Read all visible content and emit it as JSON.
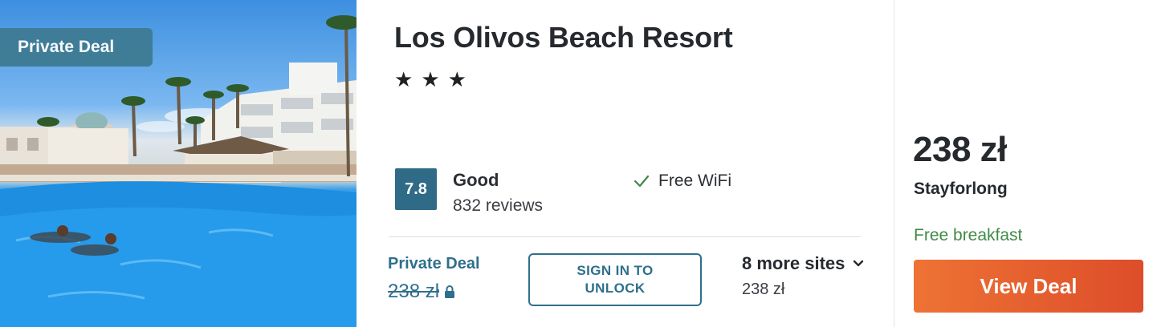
{
  "photo": {
    "badge": "Private Deal",
    "image_label": "hotel-pool-photo"
  },
  "hotel": {
    "name": "Los Olivos Beach Resort",
    "stars": [
      "★",
      "★",
      "★"
    ],
    "star_count": 3
  },
  "rating": {
    "score": "7.8",
    "label": "Good",
    "reviews": "832 reviews",
    "color": "#2f6a87"
  },
  "amenities": [
    {
      "icon": "check-icon",
      "label": "Free WiFi"
    }
  ],
  "private_deal": {
    "label": "Private Deal",
    "price": "238 zł",
    "icon": "lock-icon",
    "sign_in_label": "SIGN IN TO\nUNLOCK",
    "color": "#2f6f8c"
  },
  "more_sites": {
    "label": "8 more sites",
    "price": "238 zł",
    "icon": "chevron-down-icon"
  },
  "offer": {
    "price": "238 zł",
    "provider": "Stayforlong",
    "perk": "Free breakfast",
    "cta_label": "View Deal",
    "cta_color": "#e2582d",
    "perk_color": "#3f8a47"
  }
}
